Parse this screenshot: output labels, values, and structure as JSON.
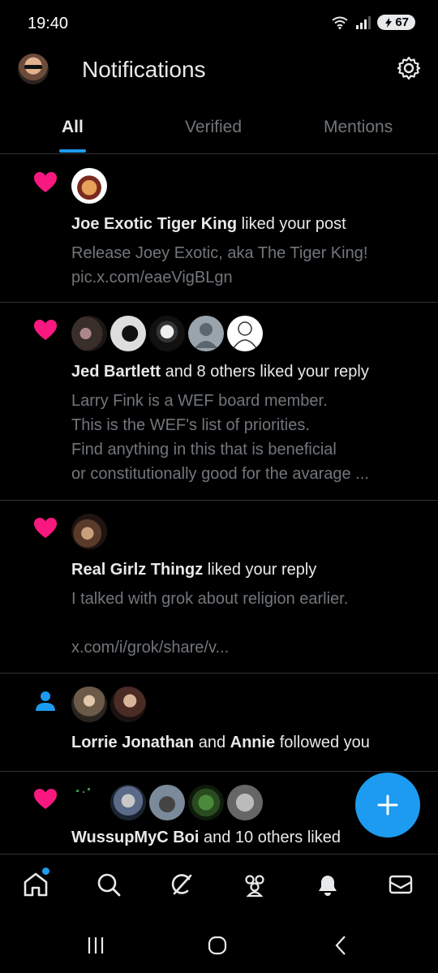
{
  "status": {
    "time": "19:40",
    "battery": "67"
  },
  "header": {
    "title": "Notifications"
  },
  "tabs": [
    {
      "label": "All",
      "active": true
    },
    {
      "label": "Verified",
      "active": false
    },
    {
      "label": "Mentions",
      "active": false
    }
  ],
  "notifications": [
    {
      "type": "like",
      "actor": "Joe Exotic Tiger King",
      "others": "",
      "action": " liked your post",
      "body": "Release Joey Exotic, aka The Tiger King!\npic.x.com/eaeVigBLgn"
    },
    {
      "type": "like",
      "actor": "Jed Bartlett",
      "others": " and 8 others",
      "action": " liked your reply",
      "body": "Larry Fink is a WEF board member.\nThis is the WEF's list of priorities.\nFind anything in this that is beneficial\nor constitutionally good for the avarage ..."
    },
    {
      "type": "like",
      "actor": "Real Girlz Thingz",
      "others": "",
      "action": " liked your reply",
      "body": "I talked with grok about religion earlier.\n\nx.com/i/grok/share/v..."
    },
    {
      "type": "follow",
      "actor": "Lorrie Jonathan",
      "and": " and ",
      "actor2": "Annie",
      "action": " followed you"
    },
    {
      "type": "like",
      "actor": "WussupMyC Boi",
      "others": " and 10 others liked",
      "action": ""
    }
  ],
  "colors": {
    "accent": "#1d9bf0",
    "like": "#f91880",
    "background": "#000000",
    "text": "#e7e9ea",
    "muted": "#71767b"
  },
  "icons": [
    "gear-icon",
    "heart-icon",
    "person-icon",
    "plus-icon",
    "home-icon",
    "search-icon",
    "grok-icon",
    "communities-icon",
    "bell-icon",
    "mail-icon"
  ]
}
